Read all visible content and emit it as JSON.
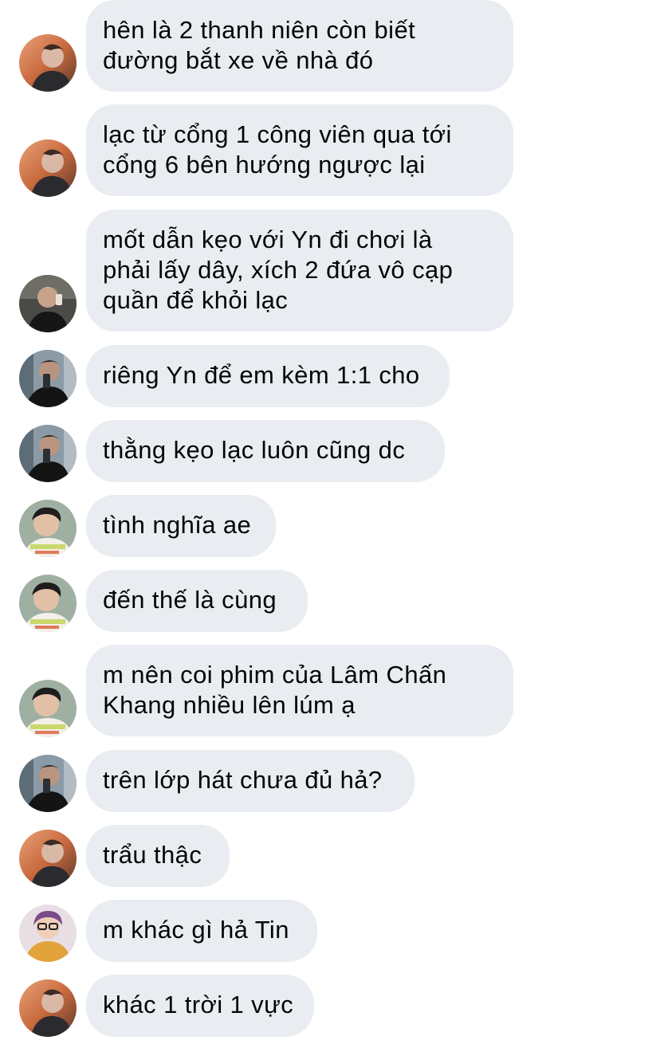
{
  "messages": [
    {
      "text": "hên là 2 thanh niên còn biết\nđường bắt xe về nhà đó",
      "avatar": "avatar-a"
    },
    {
      "text": "lạc từ cổng 1 công viên qua tới\ncổng 6 bên hướng ngược lại",
      "avatar": "avatar-a"
    },
    {
      "text": "mốt dẫn kẹo với Yn đi chơi là\nphải lấy dây, xích 2 đứa vô cạp\nquần để khỏi lạc",
      "avatar": "avatar-b"
    },
    {
      "text": "riêng Yn để em kèm 1:1 cho",
      "avatar": "avatar-c"
    },
    {
      "text": "thằng kẹo lạc luôn cũng dc",
      "avatar": "avatar-c"
    },
    {
      "text": "tình nghĩa ae",
      "avatar": "avatar-d"
    },
    {
      "text": "đến thế là cùng",
      "avatar": "avatar-d"
    },
    {
      "text": "m nên coi phim của Lâm Chấn\nKhang nhiều lên lúm ạ",
      "avatar": "avatar-d"
    },
    {
      "text": "trên lớp hát chưa đủ hả?",
      "avatar": "avatar-c"
    },
    {
      "text": "trẩu thậc",
      "avatar": "avatar-a"
    },
    {
      "text": "m khác gì hả Tin",
      "avatar": "avatar-e"
    },
    {
      "text": "khác 1 trời 1 vực",
      "avatar": "avatar-a"
    }
  ],
  "colors": {
    "bubble": "#e9ecf0",
    "text": "#050505",
    "background": "#ffffff"
  }
}
